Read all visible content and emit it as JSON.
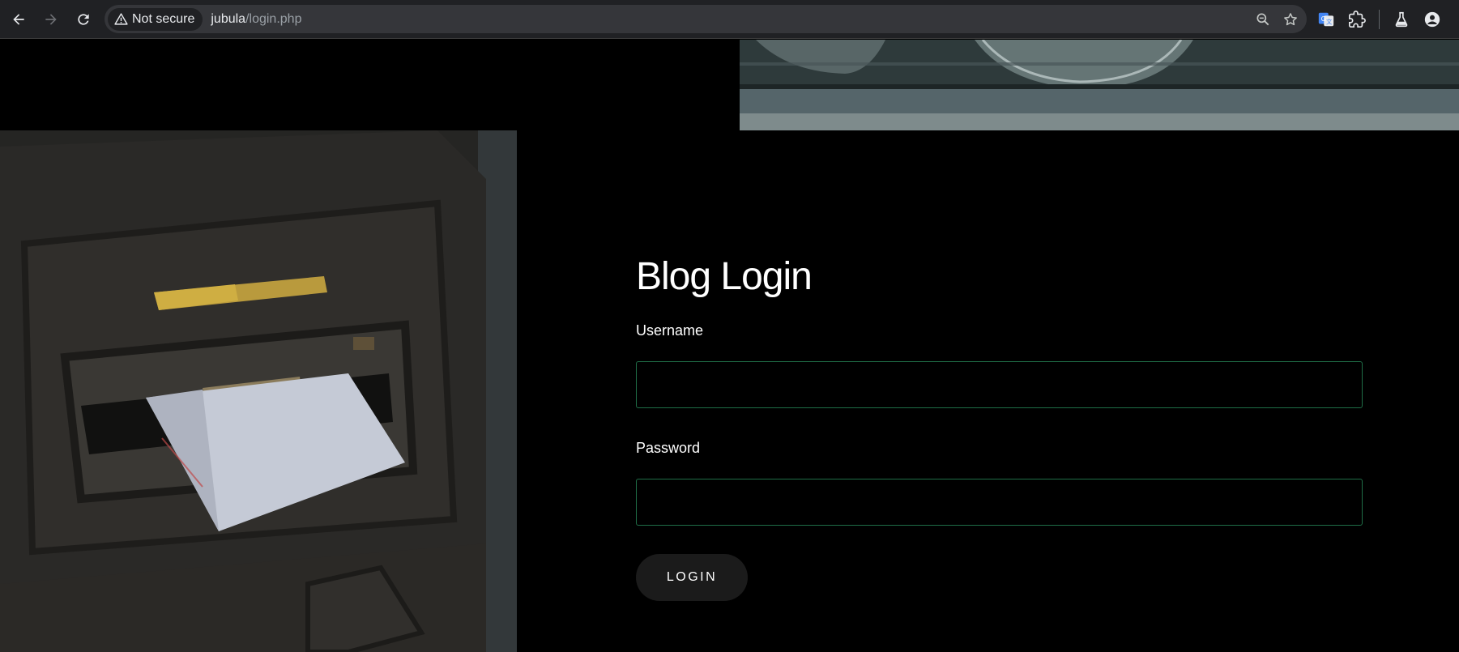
{
  "browser": {
    "security_label": "Not secure",
    "url_host": "jubula",
    "url_path": "/login.php"
  },
  "page": {
    "title": "Blog Login",
    "username_label": "Username",
    "username_value": "",
    "password_label": "Password",
    "password_value": "",
    "login_button": "LOGIN"
  },
  "colors": {
    "input_border": "#1f6e47",
    "page_background": "#000000",
    "button_background": "#1b1b1b"
  },
  "icons": {
    "back": "arrow-left-icon",
    "forward": "arrow-right-icon",
    "reload": "reload-icon",
    "warning": "warning-triangle-icon",
    "zoom": "zoom-icon",
    "bookmark": "star-icon",
    "translate": "translate-icon",
    "extensions": "puzzle-icon",
    "labs": "flask-icon",
    "profile": "profile-icon"
  }
}
